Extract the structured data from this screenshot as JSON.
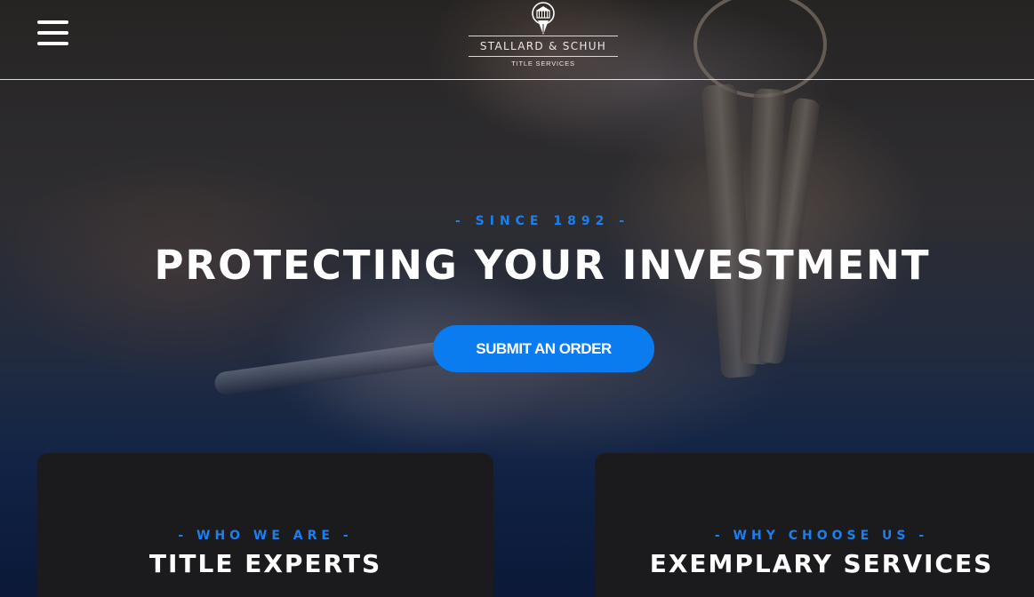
{
  "header": {
    "menu_icon": "hamburger-menu-icon",
    "logo_icon": "fountain-pen-building-icon",
    "logo_name": "STALLARD & SCHUH",
    "logo_subtitle": "TITLE  SERVICES"
  },
  "hero": {
    "eyebrow": "-   SINCE 1892   -",
    "title": "PROTECTING YOUR INVESTMENT",
    "submit_label": "SUBMIT AN ORDER"
  },
  "cards": [
    {
      "eyebrow": "-   WHO WE ARE   -",
      "title": "TITLE EXPERTS"
    },
    {
      "eyebrow": "-   WHY CHOOSE US   -",
      "title": "EXEMPLARY SERVICES"
    }
  ],
  "colors": {
    "accent": "#0b7cf0",
    "card_bg": "#1b1b1d",
    "text": "#ffffff"
  }
}
